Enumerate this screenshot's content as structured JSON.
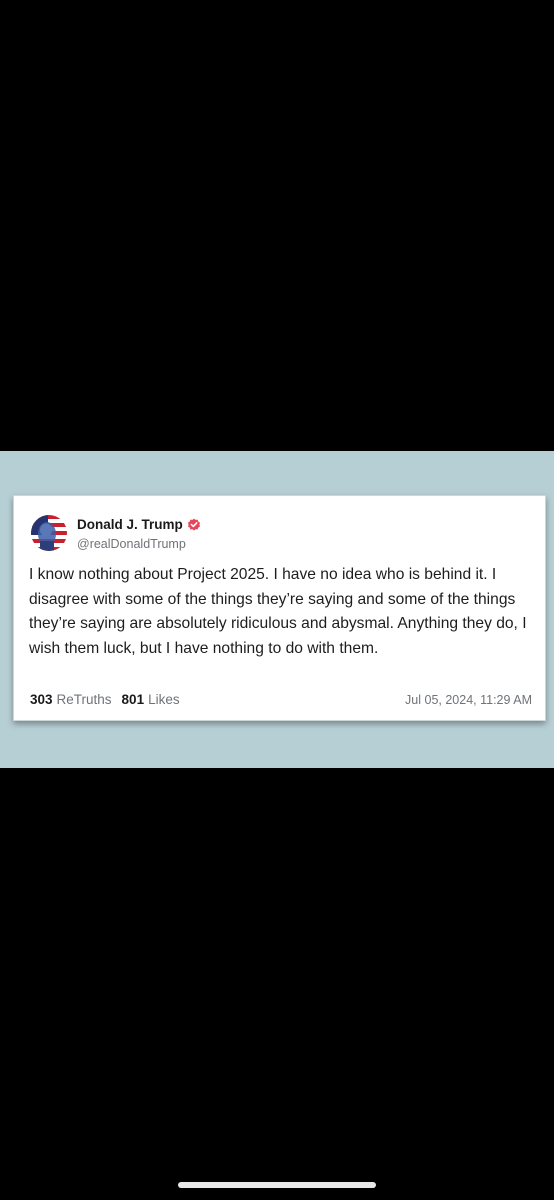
{
  "post": {
    "display_name": "Donald J. Trump",
    "handle": "@realDonaldTrump",
    "verified": true,
    "text": "I know nothing about Project 2025. I have no idea who is behind it. I disagree with some of the things they’re saying and some of the things they’re saying are absolutely ridiculous and abysmal. Anything they do, I wish them luck, but I have nothing to do with them.",
    "retruths_count": "303",
    "retruths_label": "ReTruths",
    "likes_count": "801",
    "likes_label": "Likes",
    "timestamp": "Jul 05, 2024, 11:29 AM"
  },
  "colors": {
    "background": "#000000",
    "band": "#b6cfd5",
    "card": "#ffffff",
    "verified_badge": "#e8445a",
    "muted_text": "#6f7378"
  },
  "icons": {
    "avatar": "flag-portrait-avatar",
    "verified": "verified-badge-icon"
  }
}
